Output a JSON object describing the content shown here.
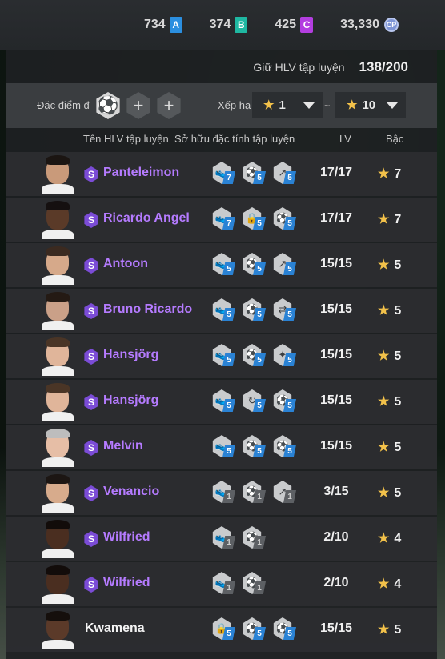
{
  "currencies": [
    {
      "amount": "734",
      "letter": "A",
      "color": "#2b8fe0"
    },
    {
      "amount": "374",
      "letter": "B",
      "color": "#1fb8a2"
    },
    {
      "amount": "425",
      "letter": "C",
      "color": "#b33ee0"
    },
    {
      "amount": "33,330",
      "letter": "CP",
      "color": "#7f96d6"
    }
  ],
  "capacity": {
    "label": "Giữ HLV tập luyện",
    "value": "138/200"
  },
  "filters": {
    "trait_label": "Đặc điểm đ",
    "rank_label": "Xếp hạ",
    "rank_from": "1",
    "rank_to": "10",
    "tilde": "~"
  },
  "headers": {
    "name": "Tên HLV tập luyện",
    "traits": "Sở hữu đặc tính tập luyện",
    "lv": "LV",
    "rank": "Bậc"
  },
  "rows": [
    {
      "name": "Panteleimon",
      "special": true,
      "skin": "#c99a7a",
      "hair": "#1b1512",
      "traits": [
        {
          "icon": "boot-icon",
          "lvl": "7",
          "blue": true
        },
        {
          "icon": "ball-icon",
          "lvl": "5",
          "blue": true
        },
        {
          "icon": "shoot-icon",
          "lvl": "5",
          "blue": true
        }
      ],
      "lv": "17/17",
      "rank": "7"
    },
    {
      "name": "Ricardo Angel",
      "special": true,
      "skin": "#5a3a28",
      "hair": "#151010",
      "traits": [
        {
          "icon": "boot-icon",
          "lvl": "7",
          "blue": true
        },
        {
          "icon": "lock-icon",
          "lvl": "5",
          "blue": true
        },
        {
          "icon": "ball-icon",
          "lvl": "5",
          "blue": true
        }
      ],
      "lv": "17/17",
      "rank": "7"
    },
    {
      "name": "Antoon",
      "special": true,
      "skin": "#d6a98a",
      "hair": "#3b2a20",
      "traits": [
        {
          "icon": "boot-icon",
          "lvl": "5",
          "blue": true
        },
        {
          "icon": "ball-icon",
          "lvl": "5",
          "blue": true
        },
        {
          "icon": "shoot-icon",
          "lvl": "5",
          "blue": true
        }
      ],
      "lv": "15/15",
      "rank": "5"
    },
    {
      "name": "Bruno Ricardo",
      "special": true,
      "skin": "#caa088",
      "hair": "#241a14",
      "traits": [
        {
          "icon": "boot-icon",
          "lvl": "5",
          "blue": true
        },
        {
          "icon": "ball-icon",
          "lvl": "5",
          "blue": true
        },
        {
          "icon": "pass-icon",
          "lvl": "5",
          "blue": true
        }
      ],
      "lv": "15/15",
      "rank": "5"
    },
    {
      "name": "Hansjörg",
      "special": true,
      "skin": "#e0b59a",
      "hair": "#4a3526",
      "traits": [
        {
          "icon": "boot-icon",
          "lvl": "5",
          "blue": true
        },
        {
          "icon": "ball-icon",
          "lvl": "5",
          "blue": true
        },
        {
          "icon": "kick-icon",
          "lvl": "5",
          "blue": true
        }
      ],
      "lv": "15/15",
      "rank": "5"
    },
    {
      "name": "Hansjörg",
      "special": true,
      "skin": "#e0b59a",
      "hair": "#4a3526",
      "traits": [
        {
          "icon": "boot-icon",
          "lvl": "5",
          "blue": true
        },
        {
          "icon": "turn-icon",
          "lvl": "5",
          "blue": true
        },
        {
          "icon": "ball-icon",
          "lvl": "5",
          "blue": true
        }
      ],
      "lv": "15/15",
      "rank": "5"
    },
    {
      "name": "Melvin",
      "special": true,
      "skin": "#e6bea6",
      "hair": "#bdbdbd",
      "traits": [
        {
          "icon": "boot-icon",
          "lvl": "5",
          "blue": true
        },
        {
          "icon": "ball-icon",
          "lvl": "5",
          "blue": true
        },
        {
          "icon": "ball-icon",
          "lvl": "5",
          "blue": true
        }
      ],
      "lv": "15/15",
      "rank": "5"
    },
    {
      "name": "Venancio",
      "special": true,
      "skin": "#d7ab8c",
      "hair": "#1c1613",
      "traits": [
        {
          "icon": "boot-icon",
          "lvl": "1",
          "blue": false
        },
        {
          "icon": "ball-icon",
          "lvl": "1",
          "blue": false
        },
        {
          "icon": "shoot-icon",
          "lvl": "1",
          "blue": false
        }
      ],
      "lv": "3/15",
      "rank": "5"
    },
    {
      "name": "Wilfried",
      "special": true,
      "skin": "#4a2e20",
      "hair": "#120c0a",
      "traits": [
        {
          "icon": "boot-icon",
          "lvl": "1",
          "blue": false
        },
        {
          "icon": "ball-icon",
          "lvl": "1",
          "blue": false
        }
      ],
      "lv": "2/10",
      "rank": "4"
    },
    {
      "name": "Wilfried",
      "special": true,
      "skin": "#4a2e20",
      "hair": "#120c0a",
      "traits": [
        {
          "icon": "boot-icon",
          "lvl": "1",
          "blue": false
        },
        {
          "icon": "ball-icon",
          "lvl": "1",
          "blue": false
        }
      ],
      "lv": "2/10",
      "rank": "4"
    },
    {
      "name": "Kwamena",
      "special": false,
      "skin": "#5b3a29",
      "hair": "#150f0c",
      "traits": [
        {
          "icon": "lock-icon",
          "lvl": "5",
          "blue": true
        },
        {
          "icon": "ball-icon",
          "lvl": "5",
          "blue": true
        },
        {
          "icon": "ball-icon",
          "lvl": "5",
          "blue": true
        }
      ],
      "lv": "15/15",
      "rank": "5"
    }
  ],
  "colors": {
    "star": "#f2c14a",
    "special_name": "#b57bff",
    "badge": "#7b4cd6"
  },
  "badge_letter": "S"
}
